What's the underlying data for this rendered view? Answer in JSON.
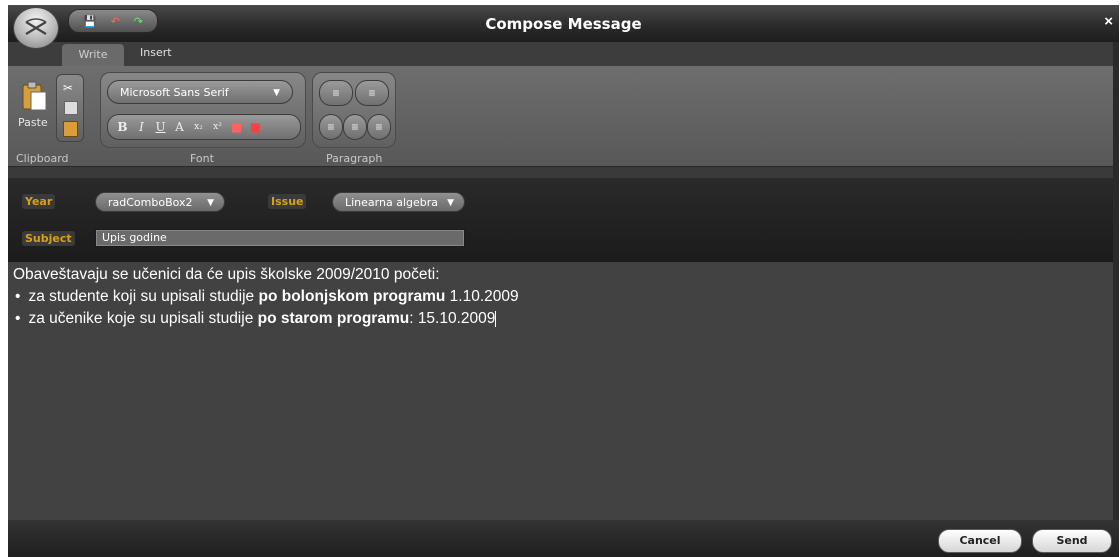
{
  "window": {
    "title": "Compose Message",
    "close_label": "×"
  },
  "quick_access": {
    "icons": [
      "save-icon",
      "undo-icon",
      "redo-icon"
    ]
  },
  "tabs": [
    {
      "label": "Write",
      "active": true
    },
    {
      "label": "Insert",
      "active": false
    }
  ],
  "ribbon": {
    "clipboard": {
      "group_label": "Clipboard",
      "paste_label": "Paste"
    },
    "font": {
      "group_label": "Font",
      "font_name": "Microsoft Sans Serif",
      "buttons": [
        "bold-icon",
        "italic-icon",
        "underline-icon",
        "font-size-icon",
        "subscript-icon",
        "superscript-icon",
        "font-color-icon",
        "highlight-icon"
      ]
    },
    "paragraph": {
      "group_label": "Paragraph",
      "buttons": [
        "bullet-list-icon",
        "numbered-list-icon",
        "align-left-icon",
        "align-center-icon",
        "align-right-icon"
      ]
    }
  },
  "form": {
    "year_label": "Year",
    "year_value": "radComboBox2",
    "issue_label": "Issue",
    "issue_value": "Linearna algebra",
    "subject_label": "Subject",
    "subject_value": "Upis godine"
  },
  "message": {
    "intro": "Obaveštavaju se učenici da će upis školske 2009/2010 početi:",
    "items": [
      {
        "prefix": "za studente koji su upisali studije ",
        "bold": "po bolonjskom programu",
        "suffix": " 1.10.2009"
      },
      {
        "prefix": "za učenike koje su upisali studije ",
        "bold": "po starom programu",
        "suffix": ": 15.10.2009"
      }
    ]
  },
  "buttons": {
    "cancel": "Cancel",
    "send": "Send"
  },
  "colors": {
    "label_accent": "#d8a018"
  }
}
